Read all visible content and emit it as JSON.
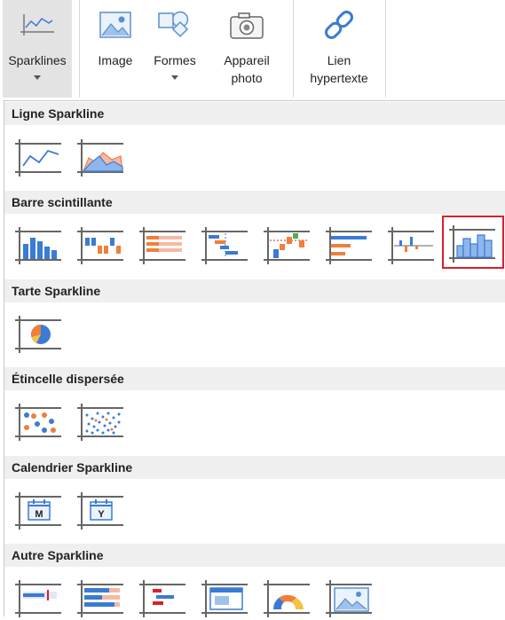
{
  "ribbon": {
    "sparklines": "Sparklines",
    "image": "Image",
    "formes": "Formes",
    "appareil_l1": "Appareil",
    "appareil_l2": "photo",
    "lien_l1": "Lien",
    "lien_l2": "hypertexte"
  },
  "sections": {
    "ligne": "Ligne Sparkline",
    "barre": "Barre scintillante",
    "tarte": "Tarte Sparkline",
    "etincelle": "Étincelle dispersée",
    "calendrier": "Calendrier Sparkline",
    "autre": "Autre Sparkline"
  },
  "calendar_letters": {
    "month": "M",
    "year": "Y"
  },
  "icons": {
    "ligne": [
      "line-sparkline-icon",
      "area-sparkline-icon"
    ],
    "barre": [
      "column-sparkline-icon",
      "winloss-sparkline-icon",
      "stacked-bar-sparkline-icon",
      "cascade-sparkline-icon",
      "vertical-cascade-sparkline-icon",
      "hbar-sparkline-icon",
      "variance-sparkline-icon",
      "histogram-sparkline-icon"
    ],
    "tarte": [
      "pie-sparkline-icon"
    ],
    "etincelle": [
      "scatter-sparkline-icon",
      "dot-scatter-sparkline-icon"
    ],
    "calendrier": [
      "month-calendar-sparkline-icon",
      "year-calendar-sparkline-icon"
    ],
    "autre": [
      "bullet-sparkline-icon",
      "progress-sparkline-icon",
      "box-plot-sparkline-icon",
      "image-area-sparkline-icon",
      "gauge-sparkline-icon",
      "picture-sparkline-icon"
    ]
  },
  "selected_item": "histogram-sparkline-icon",
  "colors": {
    "blue": "#3a7bd5",
    "orange": "#f07e3c",
    "red_outline": "#d9202a",
    "section_bg": "#efefef"
  }
}
